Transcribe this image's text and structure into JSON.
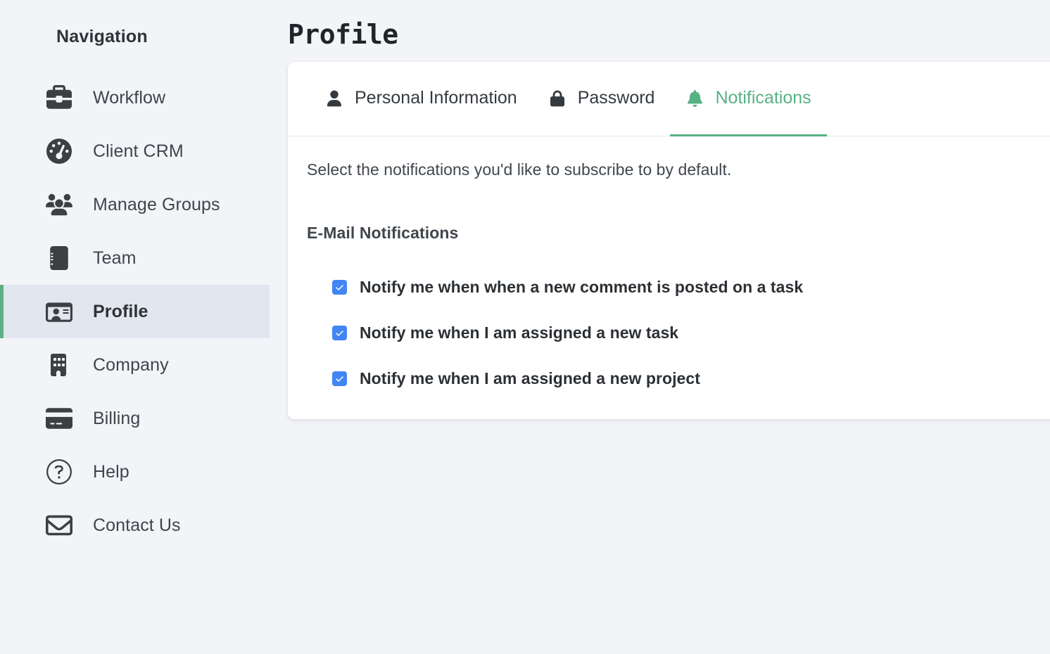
{
  "sidebar": {
    "title": "Navigation",
    "items": [
      {
        "label": "Workflow",
        "icon": "briefcase-icon",
        "active": false
      },
      {
        "label": "Client CRM",
        "icon": "gauge-icon",
        "active": false
      },
      {
        "label": "Manage Groups",
        "icon": "users-group-icon",
        "active": false
      },
      {
        "label": "Team",
        "icon": "address-book-icon",
        "active": false
      },
      {
        "label": "Profile",
        "icon": "id-card-icon",
        "active": true
      },
      {
        "label": "Company",
        "icon": "building-icon",
        "active": false
      },
      {
        "label": "Billing",
        "icon": "credit-card-icon",
        "active": false
      },
      {
        "label": "Help",
        "icon": "question-circle-icon",
        "active": false
      },
      {
        "label": "Contact Us",
        "icon": "envelope-icon",
        "active": false
      }
    ]
  },
  "main": {
    "page_title": "Profile",
    "tabs": [
      {
        "label": "Personal Information",
        "icon": "person-icon",
        "active": false
      },
      {
        "label": "Password",
        "icon": "lock-icon",
        "active": false
      },
      {
        "label": "Notifications",
        "icon": "bell-icon",
        "active": true
      }
    ],
    "intro": "Select the notifications you'd like to subscribe to by default.",
    "section_heading": "E-Mail Notifications",
    "notifications": [
      {
        "label": "Notify me when when a new comment is posted on a task",
        "checked": true
      },
      {
        "label": "Notify me when I am assigned a new task",
        "checked": true
      },
      {
        "label": "Notify me when I am assigned a new project",
        "checked": true
      }
    ]
  },
  "colors": {
    "accent_green": "#57b283",
    "active_nav_bg": "#e2e6ee",
    "checkbox_blue": "#4285f4",
    "page_bg": "#f2f4f8",
    "card_bg": "#ffffff",
    "text_primary": "#343a40"
  }
}
